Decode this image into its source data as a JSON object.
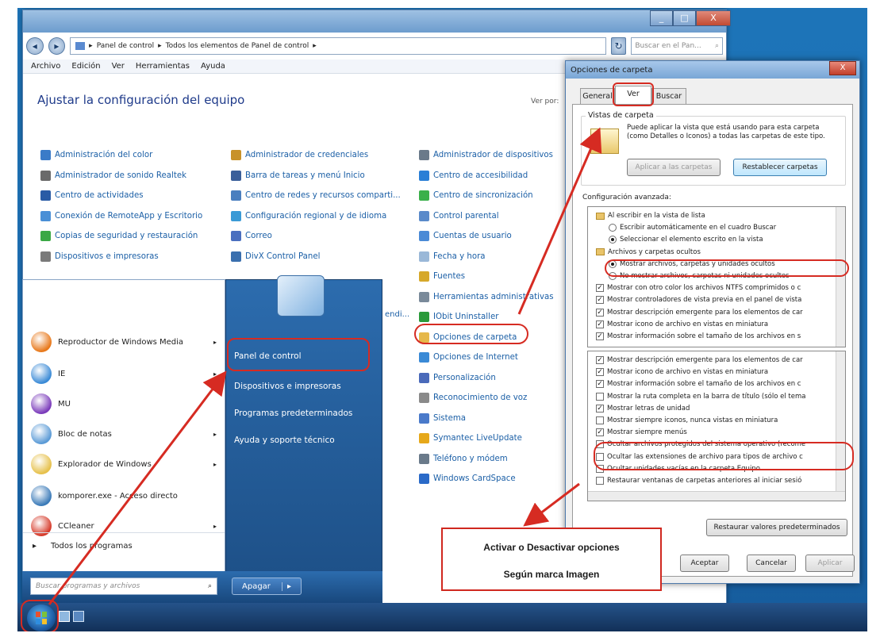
{
  "control_panel": {
    "breadcrumb": [
      "Panel de control",
      "Todos los elementos de Panel de control"
    ],
    "search_placeholder": "Buscar en el Pan...",
    "menu": [
      "Archivo",
      "Edición",
      "Ver",
      "Herramientas",
      "Ayuda"
    ],
    "heading": "Ajustar la configuración del equipo",
    "view_by": "Ver por:",
    "window_buttons": [
      "_",
      "□",
      "X"
    ],
    "col1": [
      {
        "label": "Administración del color",
        "icon": "color-icon",
        "color": "#3a7bc8"
      },
      {
        "label": "Administrador de sonido Realtek",
        "icon": "speaker-icon",
        "color": "#6a6a6a"
      },
      {
        "label": "Centro de actividades",
        "icon": "flag-icon",
        "color": "#2a5ba5"
      },
      {
        "label": "Conexión de RemoteApp y Escritorio",
        "icon": "remote-icon",
        "color": "#4a8fd6"
      },
      {
        "label": "Copias de seguridad y restauración",
        "icon": "backup-icon",
        "color": "#3aa845"
      },
      {
        "label": "Dispositivos e impresoras",
        "icon": "printer-icon",
        "color": "#7a7a7a"
      }
    ],
    "col2": [
      {
        "label": "Administrador de credenciales",
        "icon": "vault-icon",
        "color": "#c8922a"
      },
      {
        "label": "Barra de tareas y menú Inicio",
        "icon": "taskbar-icon",
        "color": "#3a5f9a"
      },
      {
        "label": "Centro de redes y recursos comparti...",
        "icon": "network-icon",
        "color": "#4a7fbf"
      },
      {
        "label": "Configuración regional y de idioma",
        "icon": "globe-icon",
        "color": "#3a9ad6"
      },
      {
        "label": "Correo",
        "icon": "mail-icon",
        "color": "#4a6fbf"
      },
      {
        "label": "DivX Control Panel",
        "icon": "divx-icon",
        "color": "#3a6fae"
      }
    ],
    "col3": [
      {
        "label": "Administrador de dispositivos",
        "icon": "device-manager-icon",
        "color": "#6a7a8a"
      },
      {
        "label": "Centro de accesibilidad",
        "icon": "accessibility-icon",
        "color": "#2a7fd6"
      },
      {
        "label": "Centro de sincronización",
        "icon": "sync-icon",
        "color": "#3ab04a"
      },
      {
        "label": "Control parental",
        "icon": "parental-icon",
        "color": "#5a8aca"
      },
      {
        "label": "Cuentas de usuario",
        "icon": "users-icon",
        "color": "#4a8ad6"
      },
      {
        "label": "Fecha y hora",
        "icon": "clock-icon",
        "color": "#9ab8d8"
      },
      {
        "label": "Fuentes",
        "icon": "fonts-icon",
        "color": "#d6a82a"
      },
      {
        "label": "Herramientas administrativas",
        "icon": "admin-tools-icon",
        "color": "#7a8a9a"
      },
      {
        "label": "IObit Uninstaller",
        "icon": "iobit-icon",
        "color": "#2a9a3a"
      },
      {
        "label": "Opciones de carpeta",
        "icon": "folder-options-icon",
        "color": "#e6b84a"
      },
      {
        "label": "Opciones de Internet",
        "icon": "internet-icon",
        "color": "#3a8ad6"
      },
      {
        "label": "Personalización",
        "icon": "personalize-icon",
        "color": "#4a6aba"
      },
      {
        "label": "Reconocimiento de voz",
        "icon": "mic-icon",
        "color": "#8a8a8a"
      },
      {
        "label": "Sistema",
        "icon": "system-icon",
        "color": "#4a7aca"
      },
      {
        "label": "Symantec LiveUpdate",
        "icon": "symantec-icon",
        "color": "#e6a81a"
      },
      {
        "label": "Teléfono y módem",
        "icon": "phone-icon",
        "color": "#6a7a8a"
      },
      {
        "label": "Windows CardSpace",
        "icon": "cardspace-icon",
        "color": "#2a6ac8"
      }
    ],
    "partial_text": "endi..."
  },
  "start_menu": {
    "left_items": [
      {
        "label": "Reproductor de Windows Media",
        "icon": "media-player-icon",
        "color": "#e8781a",
        "arrow": "▸"
      },
      {
        "label": "IE",
        "icon": "ie-icon",
        "color": "#3a8ad6",
        "arrow": "▸"
      },
      {
        "label": "MU",
        "icon": "mu-icon",
        "color": "#7a3aba",
        "arrow": ""
      },
      {
        "label": "Bloc de notas",
        "icon": "notepad-icon",
        "color": "#5a9ad6",
        "arrow": "▸"
      },
      {
        "label": "Explorador de Windows",
        "icon": "explorer-icon",
        "color": "#e6c04a",
        "arrow": "▸"
      },
      {
        "label": "komporer.exe - Acceso directo",
        "icon": "kompozer-icon",
        "color": "#3a7ab8",
        "arrow": ""
      },
      {
        "label": "CCleaner",
        "icon": "ccleaner-icon",
        "color": "#d63a2a",
        "arrow": "▸"
      }
    ],
    "all_programs": "Todos los programas",
    "search_placeholder": "Buscar programas y archivos",
    "right_items": [
      "Panel de control",
      "Dispositivos e impresoras",
      "Programas predeterminados",
      "Ayuda y soporte técnico"
    ],
    "shutdown": "Apagar"
  },
  "folder_options": {
    "title": "Opciones de carpeta",
    "close_label": "X",
    "tabs": [
      "General",
      "Ver",
      "Buscar"
    ],
    "folder_views_title": "Vistas de carpeta",
    "folder_views_text": "Puede aplicar la vista que está usando para esta carpeta (como Detalles o Iconos) a todas las carpetas de este tipo.",
    "apply_button": "Aplicar a las carpetas",
    "reset_button": "Restablecer carpetas",
    "advanced_title": "Configuración avanzada:",
    "list_top": [
      {
        "kind": "folder",
        "label": "Al escribir en la vista de lista"
      },
      {
        "kind": "radio",
        "on": false,
        "label": "Escribir automáticamente en el cuadro Buscar"
      },
      {
        "kind": "radio",
        "on": true,
        "label": "Seleccionar el elemento escrito en la vista"
      },
      {
        "kind": "folder",
        "label": "Archivos y carpetas ocultos"
      },
      {
        "kind": "radio",
        "on": true,
        "label": "Mostrar archivos, carpetas y unidades ocultos"
      },
      {
        "kind": "radio",
        "on": false,
        "label": "No mostrar archivos, carpetas ni unidades ocultos"
      },
      {
        "kind": "check",
        "on": true,
        "label": "Mostrar con otro color los archivos NTFS comprimidos o c"
      },
      {
        "kind": "check",
        "on": true,
        "label": "Mostrar controladores de vista previa en el panel de vista"
      },
      {
        "kind": "check",
        "on": true,
        "label": "Mostrar descripción emergente para los elementos de car"
      },
      {
        "kind": "check",
        "on": true,
        "label": "Mostrar icono de archivo en vistas en miniatura"
      },
      {
        "kind": "check",
        "on": true,
        "label": "Mostrar información sobre el tamaño de los archivos en s"
      }
    ],
    "list_bottom": [
      {
        "kind": "check",
        "on": true,
        "label": "Mostrar descripción emergente para los elementos de car"
      },
      {
        "kind": "check",
        "on": true,
        "label": "Mostrar icono de archivo en vistas en miniatura"
      },
      {
        "kind": "check",
        "on": true,
        "label": "Mostrar información sobre el tamaño de los archivos en c"
      },
      {
        "kind": "check",
        "on": false,
        "label": "Mostrar la ruta completa en la barra de título (sólo el tema"
      },
      {
        "kind": "check",
        "on": true,
        "label": "Mostrar letras de unidad"
      },
      {
        "kind": "check",
        "on": false,
        "label": "Mostrar siempre iconos, nunca vistas en miniatura"
      },
      {
        "kind": "check",
        "on": true,
        "label": "Mostrar siempre menús"
      },
      {
        "kind": "check",
        "on": false,
        "label": "Ocultar archivos protegidos del sistema operativo (recome"
      },
      {
        "kind": "check",
        "on": false,
        "label": "Ocultar las extensiones de archivo para tipos de archivo c"
      },
      {
        "kind": "check",
        "on": false,
        "label": "Ocultar unidades vacías en la carpeta Equipo"
      },
      {
        "kind": "check",
        "on": false,
        "label": "Restaurar ventanas de carpetas anteriores al iniciar sesió"
      }
    ],
    "restore_defaults": "Restaurar valores predeterminados",
    "ok": "Aceptar",
    "cancel": "Cancelar",
    "apply": "Aplicar"
  },
  "callout": {
    "line1": "Activar o Desactivar opciones",
    "line2": "Según marca Imagen"
  },
  "highlight_color": "#d62b22"
}
